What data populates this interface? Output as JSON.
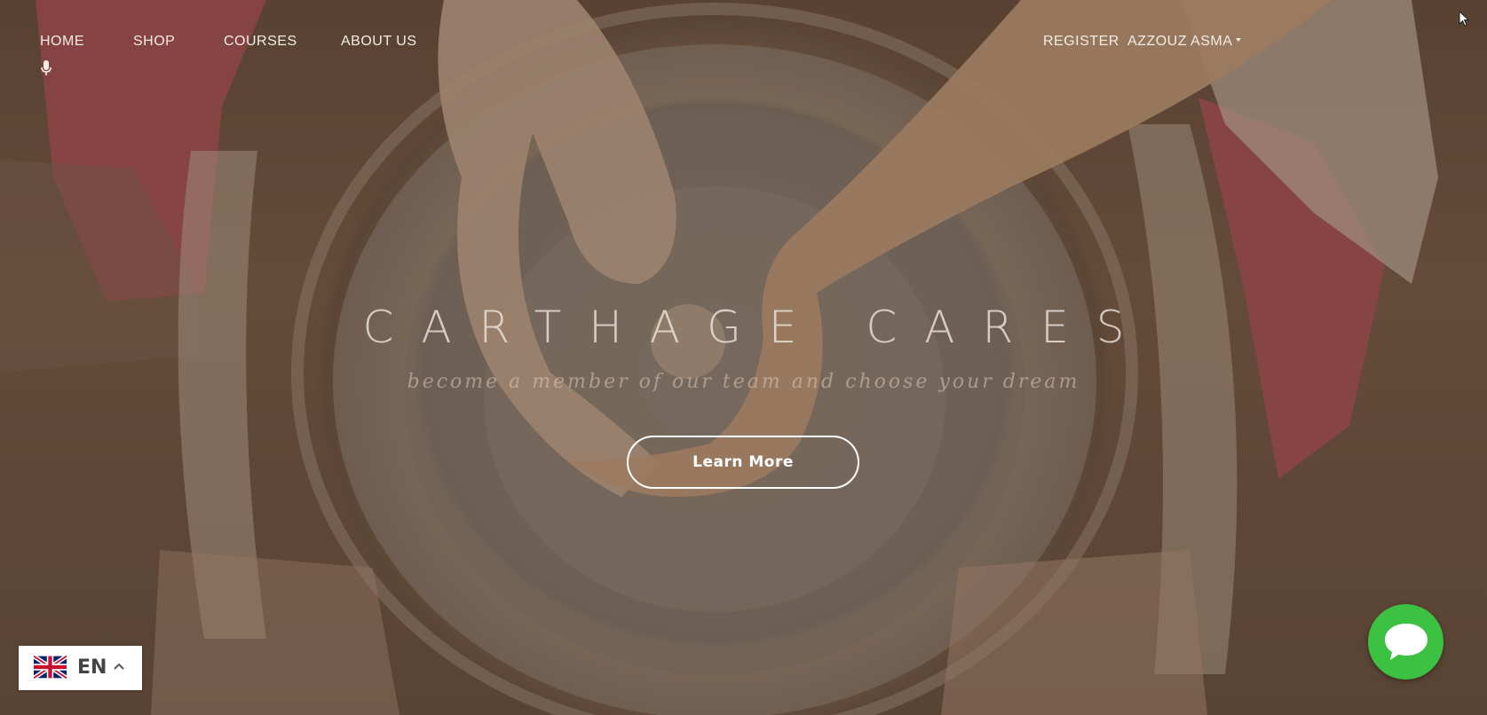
{
  "nav": {
    "home": "HOME",
    "shop": "SHOP",
    "courses": "COURSES",
    "about": "ABOUT US",
    "register": "REGISTER",
    "user": "AZZOUZ ASMA"
  },
  "hero": {
    "title": "CARTHAGE CARES",
    "tagline": "become a member of our team and choose your dream",
    "cta": "Learn More"
  },
  "language": {
    "code": "EN",
    "flag": "uk-flag-icon"
  },
  "icons": {
    "mic": "microphone-icon",
    "chat": "chat-bubble-icon",
    "user_menu": "caret-down-icon",
    "language_toggle": "chevron-up-icon"
  },
  "colors": {
    "nav_text": "#f3ece4",
    "chat_green": "#3cc142",
    "cta_border": "#ffffff"
  }
}
